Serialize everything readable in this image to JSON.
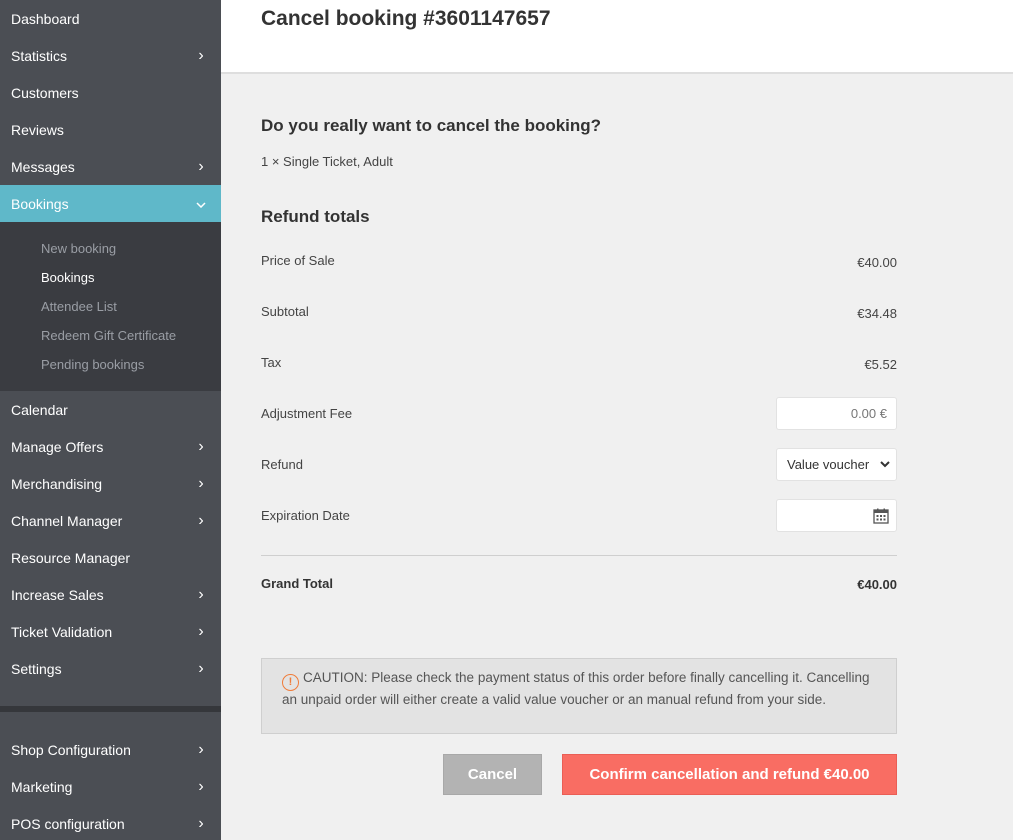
{
  "sidebar": {
    "items": [
      {
        "label": "Dashboard"
      },
      {
        "label": "Statistics"
      },
      {
        "label": "Customers"
      },
      {
        "label": "Reviews"
      },
      {
        "label": "Messages"
      },
      {
        "label": "Bookings"
      },
      {
        "label": "Calendar"
      },
      {
        "label": "Manage Offers"
      },
      {
        "label": "Merchandising"
      },
      {
        "label": "Channel Manager"
      },
      {
        "label": "Resource Manager"
      },
      {
        "label": "Increase Sales"
      },
      {
        "label": "Ticket Validation"
      },
      {
        "label": "Settings"
      },
      {
        "label": "Shop Configuration"
      },
      {
        "label": "Marketing"
      },
      {
        "label": "POS configuration"
      }
    ],
    "bookings_submenu": [
      {
        "label": "New booking"
      },
      {
        "label": "Bookings"
      },
      {
        "label": "Attendee List"
      },
      {
        "label": "Redeem Gift Certificate"
      },
      {
        "label": "Pending bookings"
      }
    ],
    "chevron_right": "›",
    "chevron_down": "⌄"
  },
  "page": {
    "title": "Cancel booking #3601147657"
  },
  "cancel": {
    "question": "Do you really want to cancel the booking?",
    "item_line": "1 × Single Ticket, Adult",
    "refund_totals_title": "Refund totals",
    "rows": {
      "price_of_sale": {
        "label": "Price of Sale",
        "value": "€40.00"
      },
      "subtotal": {
        "label": "Subtotal",
        "value": "€34.48"
      },
      "tax": {
        "label": "Tax",
        "value": "€5.52"
      },
      "adjustment_fee": {
        "label": "Adjustment Fee",
        "value": "0.00 €"
      },
      "refund": {
        "label": "Refund",
        "selected": "Value voucher"
      },
      "expiration_date": {
        "label": "Expiration Date",
        "value": ""
      }
    },
    "grand_total": {
      "label": "Grand Total",
      "value": "€40.00"
    },
    "caution_text": "CAUTION: Please check the payment status of this order before finally cancelling it. Cancelling an unpaid order will either create a valid value voucher or an manual refund from your side.",
    "caution_icon": "!",
    "buttons": {
      "cancel": "Cancel",
      "confirm": "Confirm cancellation and refund €40.00"
    }
  },
  "colors": {
    "sidebar_bg": "#4b4e54",
    "sidebar_active": "#5fb8c9",
    "confirm_button": "#f96d63",
    "cancel_button": "#b3b3b3",
    "caution_icon": "#f07c3a"
  }
}
